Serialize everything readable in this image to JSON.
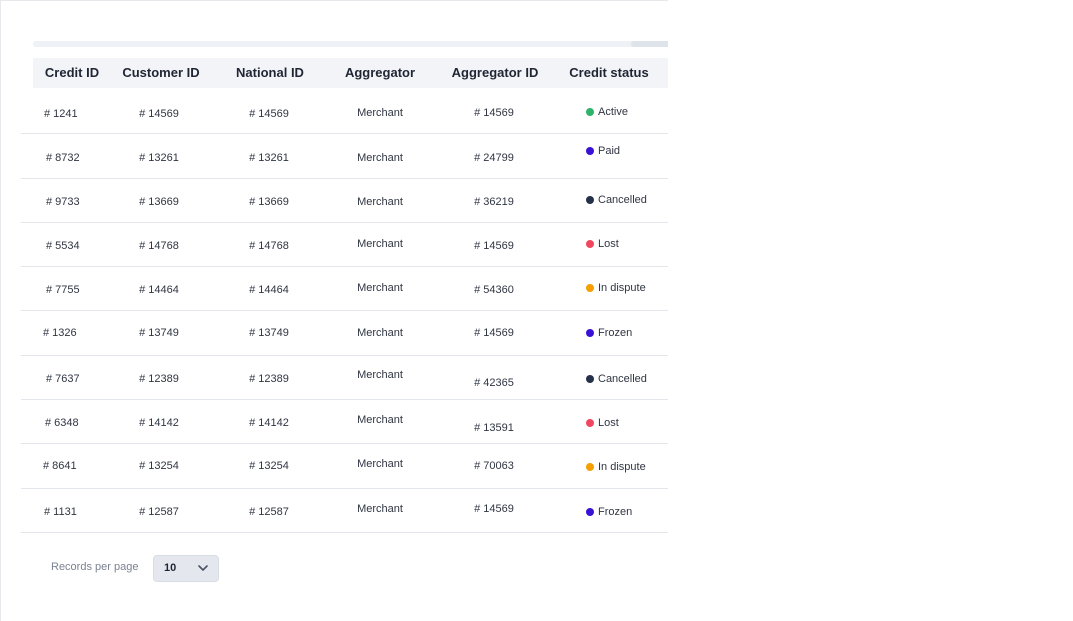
{
  "table": {
    "columns": [
      "Credit ID",
      "Customer  ID",
      "National  ID",
      "Aggregator",
      "Aggregator ID",
      "Credit status"
    ],
    "rows": [
      {
        "credit_id": "# 1241",
        "customer_id": "# 14569",
        "national_id": "# 14569",
        "aggregator": "Merchant",
        "aggregator_id": "# 14569",
        "status": "Active",
        "status_color": "#2fb36b"
      },
      {
        "credit_id": "# 8732",
        "customer_id": "# 13261",
        "national_id": "# 13261",
        "aggregator": "Merchant",
        "aggregator_id": "# 24799",
        "status": "Paid",
        "status_color": "#3a12d6"
      },
      {
        "credit_id": "# 9733",
        "customer_id": "# 13669",
        "national_id": "# 13669",
        "aggregator": "Merchant",
        "aggregator_id": "# 36219",
        "status": "Cancelled",
        "status_color": "#25304a"
      },
      {
        "credit_id": "# 5534",
        "customer_id": "# 14768",
        "national_id": "# 14768",
        "aggregator": "Merchant",
        "aggregator_id": "# 14569",
        "status": "Lost",
        "status_color": "#f0475e"
      },
      {
        "credit_id": "# 7755",
        "customer_id": "# 14464",
        "national_id": "# 14464",
        "aggregator": "Merchant",
        "aggregator_id": "# 54360",
        "status": "In dispute",
        "status_color": "#f5a000"
      },
      {
        "credit_id": "# 1326",
        "customer_id": "# 13749",
        "national_id": "# 13749",
        "aggregator": "Merchant",
        "aggregator_id": "# 14569",
        "status": "Frozen",
        "status_color": "#3a12d6"
      },
      {
        "credit_id": "# 7637",
        "customer_id": "# 12389",
        "national_id": "# 12389",
        "aggregator": "Merchant",
        "aggregator_id": "# 42365",
        "status": "Cancelled",
        "status_color": "#25304a"
      },
      {
        "credit_id": "# 6348",
        "customer_id": "# 14142",
        "national_id": "# 14142",
        "aggregator": "Merchant",
        "aggregator_id": "# 13591",
        "status": "Lost",
        "status_color": "#f0475e"
      },
      {
        "credit_id": "# 8641",
        "customer_id": "# 13254",
        "national_id": "# 13254",
        "aggregator": "Merchant",
        "aggregator_id": "# 70063",
        "status": "In dispute",
        "status_color": "#f5a000"
      },
      {
        "credit_id": "# 1131",
        "customer_id": "# 12587",
        "national_id": "# 12587",
        "aggregator": "Merchant",
        "aggregator_id": "# 14569",
        "status": "Frozen",
        "status_color": "#3a12d6"
      }
    ]
  },
  "pagination": {
    "records_label": "Records per page",
    "per_page_value": "10",
    "select_icon": "chevron-down-icon"
  }
}
